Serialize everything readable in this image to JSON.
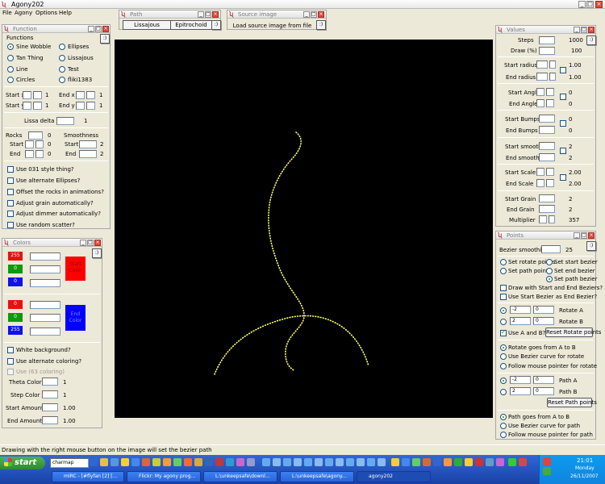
{
  "window": {
    "title": "Agony202",
    "menu": [
      "File",
      "Agony",
      "Options",
      "Help"
    ]
  },
  "canvas": {
    "bg": "#000000",
    "dot_color": "#ffff66"
  },
  "path_panel": {
    "title": "Path",
    "tabs": [
      "Lissajous",
      "Epitrochoid"
    ],
    "smile": ":)"
  },
  "source_panel": {
    "title": "Source image",
    "load_button": "Load source image from file",
    "smile": ":)"
  },
  "function_panel": {
    "title": "Function",
    "group_label": "Functions",
    "smile": ":)",
    "functions_left": [
      "Sine Wobble",
      "Tan Thing",
      "Line",
      "Circles"
    ],
    "functions_right": [
      "Ellipses",
      "Lissajous",
      "Test",
      "fliki1383"
    ],
    "selected": "Sine Wobble",
    "start_x": "Start x",
    "start_x_val": "1",
    "end_x": "End x",
    "end_x_val": "1",
    "start_y": "Start y",
    "start_y_val": "1",
    "end_y": "End y",
    "end_y_val": "1",
    "lissa_delta": "Lissa delta",
    "lissa_delta_val": "1",
    "rocks": "Rocks",
    "rocks_val": "0",
    "rocks_start": "Start",
    "rocks_start_val": "0",
    "rocks_end": "End",
    "rocks_end_val": "0",
    "smoothness": "Smoothness",
    "smooth_start": "Start",
    "smooth_start_val": "2",
    "smooth_end": "End",
    "smooth_end_val": "2",
    "checks": [
      "Use 031 style thing?",
      "Use alternate Ellipses?",
      "Offset the rocks in animations?",
      "Adjust grain automatically?",
      "Adjust dimmer automatically?",
      "Use random scatter?"
    ]
  },
  "colors_panel": {
    "title": "Colors",
    "smile": ":)",
    "start_r": "255",
    "start_g": "0",
    "start_b": "0",
    "start_label": "Start Color",
    "start_color": "#ff0000",
    "end_r": "0",
    "end_g": "0",
    "end_b": "255",
    "end_label": "End Color",
    "end_color": "#0000ff",
    "checks": [
      "White background?",
      "Use alternate coloring?",
      "Use (63 coloring)"
    ],
    "theta": "Theta Color",
    "theta_val": "1",
    "step": "Step Color",
    "step_val": "1",
    "start_amount": "Start Amount",
    "start_amount_val": "1.00",
    "end_amount": "End Amount",
    "end_amount_val": "1.00"
  },
  "values_panel": {
    "title": "Values",
    "smile": ":)",
    "steps": "Steps",
    "steps_val": "1000",
    "draw": "Draw (%)",
    "draw_val": "100",
    "start_radius": "Start radius",
    "start_radius_val": "1.00",
    "end_radius": "End radius",
    "end_radius_val": "1.00",
    "start_angle": "Start Angle",
    "start_angle_val": "0",
    "end_angle": "End Angle",
    "end_angle_val": "0",
    "start_bumps": "Start Bumps",
    "start_bumps_val": "0",
    "end_bumps": "End Bumps",
    "end_bumps_val": "0",
    "start_smooth": "Start smooth",
    "start_smooth_val": "2",
    "end_smooth": "End smooth",
    "end_smooth_val": "2",
    "start_scale": "Start Scale",
    "start_scale_val": "2.00",
    "end_scale": "End Scale",
    "end_scale_val": "2.00",
    "start_grain": "Start Grain",
    "start_grain_val": "2",
    "end_grain": "End Grain",
    "end_grain_val": "2",
    "multiplier": "Multiplier",
    "multiplier_val": "357"
  },
  "points_panel": {
    "title": "Points",
    "smile": ":)",
    "bezier_smoothing": "Bezier smoothing",
    "bezier_smoothing_val": "25",
    "set_rotate": "Set rotate points",
    "set_start_bezier": "Set start bezier",
    "set_path": "Set path points",
    "set_end_bezier": "Set end bezier",
    "set_path_bezier": "Set path bezier",
    "draw_start_end": "Draw with Start and End Beziers?",
    "use_start_as_end": "Use Start Bezier as End Bezier?",
    "rot_a1": "-2",
    "rot_a2": "0",
    "rotate_a": "Rotate A",
    "rot_b1": "2",
    "rot_b2": "0",
    "rotate_b": "Rotate B",
    "use_ab": "Use A and B?",
    "reset_rotate": "Reset Rotate points",
    "rot_goes": "Rotate goes from A to B",
    "rot_bezier": "Use Bezier curve for rotate",
    "rot_mouse": "Follow mouse pointer for rotate",
    "path_a1": "-2",
    "path_a2": "0",
    "path_a": "Path A",
    "path_b1": "2",
    "path_b2": "0",
    "path_b": "Path B",
    "reset_path": "Reset Path points",
    "path_goes": "Path goes from A to B",
    "path_bezier": "Use Bezier curve for path",
    "path_mouse": "Follow mouse pointer for path"
  },
  "status": "Drawing with the right mouse button on the image will set the bezier path",
  "taskbar": {
    "start": "start",
    "address": "charmap",
    "tasks": [
      "mIRC - [#flyfan [2] [...",
      "Flickr: My agony prog...",
      "L:\\unkeepsafe\\downl...",
      "L:\\unkeepsafe\\agony...",
      "agony202"
    ],
    "time": "21:01",
    "day": "Monday",
    "date": "26/11/2007"
  }
}
